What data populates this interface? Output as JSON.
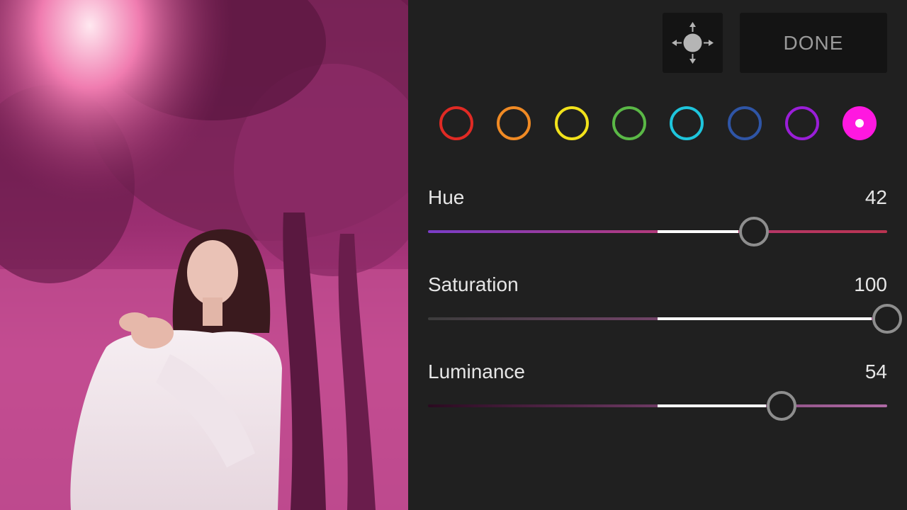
{
  "photo": {
    "description_icon": "edited-photo-portrait"
  },
  "toolbar": {
    "move_icon": "target-adjustment-move-icon",
    "done_label": "DONE"
  },
  "color_swatches": [
    {
      "name": "red",
      "color": "#e02a24",
      "selected": false
    },
    {
      "name": "orange",
      "color": "#f08a24",
      "selected": false
    },
    {
      "name": "yellow",
      "color": "#f2e21b",
      "selected": false
    },
    {
      "name": "green",
      "color": "#5ab846",
      "selected": false
    },
    {
      "name": "aqua",
      "color": "#1ec5dc",
      "selected": false
    },
    {
      "name": "blue",
      "color": "#2f55a6",
      "selected": false
    },
    {
      "name": "purple",
      "color": "#9a1ed8",
      "selected": true
    },
    {
      "name": "magenta",
      "color": "#ff18e0",
      "selected": true
    }
  ],
  "sliders": {
    "hue": {
      "label": "Hue",
      "value": "42",
      "level": 42,
      "min": -100,
      "max": 100,
      "gradient_colors": [
        "#7a3cc8",
        "#b23a7c",
        "#b93350"
      ]
    },
    "saturation": {
      "label": "Saturation",
      "value": "100",
      "level": 100,
      "min": -100,
      "max": 100,
      "gradient_colors": [
        "#3c3c3c",
        "#a84c94"
      ]
    },
    "luminance": {
      "label": "Luminance",
      "value": "54",
      "level": 54,
      "min": -100,
      "max": 100,
      "gradient_colors": [
        "#2a0a20",
        "#b06aa6"
      ]
    }
  }
}
